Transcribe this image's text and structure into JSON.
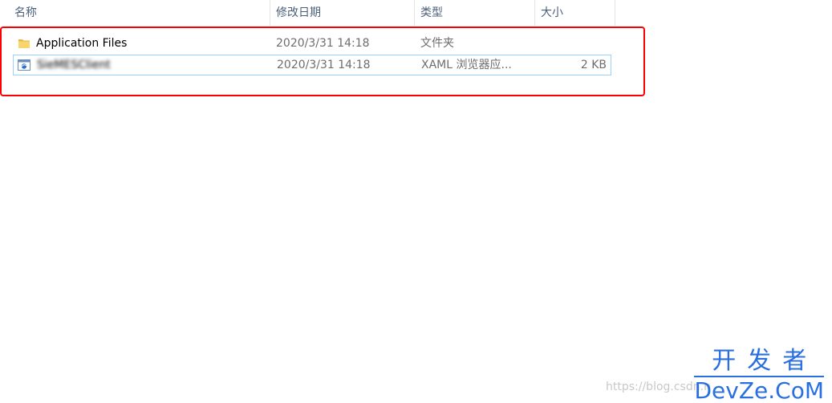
{
  "columns": {
    "name": "名称",
    "date": "修改日期",
    "type": "类型",
    "size": "大小",
    "sort_indicator": "^"
  },
  "files": [
    {
      "icon": "folder-icon",
      "name": "Application Files",
      "modified": "2020/3/31 14:18",
      "type": "文件夹",
      "size": ""
    },
    {
      "icon": "xbap-app-icon",
      "name": "SieMESClient",
      "modified": "2020/3/31 14:18",
      "type": "XAML 浏览器应...",
      "size": "2 KB"
    }
  ],
  "colors": {
    "highlight": "#ff0000",
    "selection_border": "#99d1ff",
    "watermark_brand": "#2a6fe0"
  },
  "watermarks": {
    "csdn": "https://blog.csdn.n",
    "brand_cn": "开发者",
    "brand_en": "DevZe.CoM"
  }
}
